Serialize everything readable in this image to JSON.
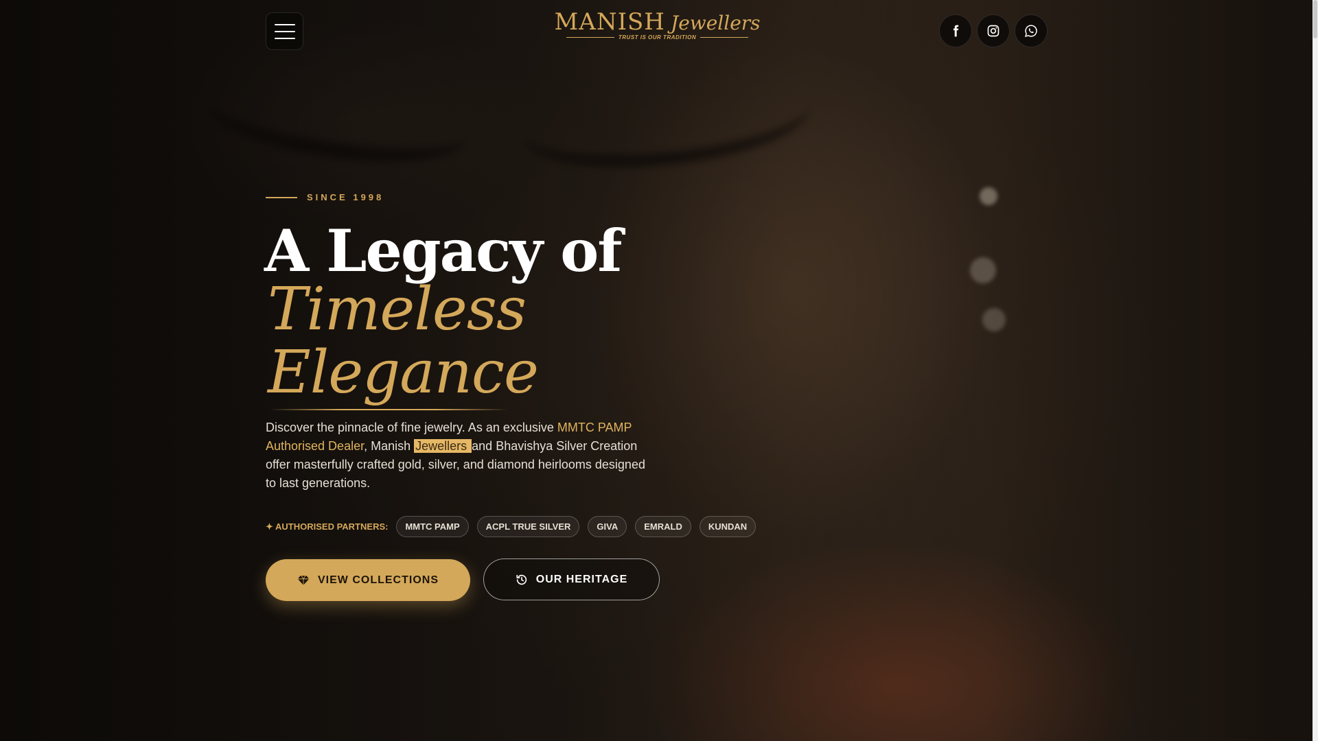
{
  "header": {
    "menu_icon": "hamburger-menu-icon",
    "logo": {
      "word1": "MANISH",
      "word2": "Jewellers",
      "tagline": "TRUST IS OUR TRADITION"
    },
    "social": [
      {
        "name": "facebook-icon"
      },
      {
        "name": "instagram-icon"
      },
      {
        "name": "whatsapp-icon"
      }
    ]
  },
  "hero": {
    "eyebrow": "SINCE 1998",
    "title_line1": "A Legacy of",
    "title_line2": "Timeless",
    "title_line3": "Elegance",
    "description": {
      "part1": "Discover the pinnacle of fine jewelry. As an exclusive ",
      "gold": "MMTC PAMP Authorised Dealer",
      "part2": ", Manish ",
      "highlight": "Jewellers ",
      "part3": "and Bhavishya Silver Creation offer masterfully crafted gold, silver, and diamond heirlooms designed to last generations."
    },
    "partners_label": "✦ AUTHORISED PARTNERS:",
    "partners": [
      "MMTC PAMP",
      "ACPL TRUE SILVER",
      "GIVA",
      "EMRALD",
      "KUNDAN"
    ],
    "primary_button": "VIEW COLLECTIONS",
    "secondary_button": "OUR HERITAGE"
  },
  "colors": {
    "accent": "#d4a85a",
    "text": "#e8e0d4",
    "background": "#1a1410"
  }
}
